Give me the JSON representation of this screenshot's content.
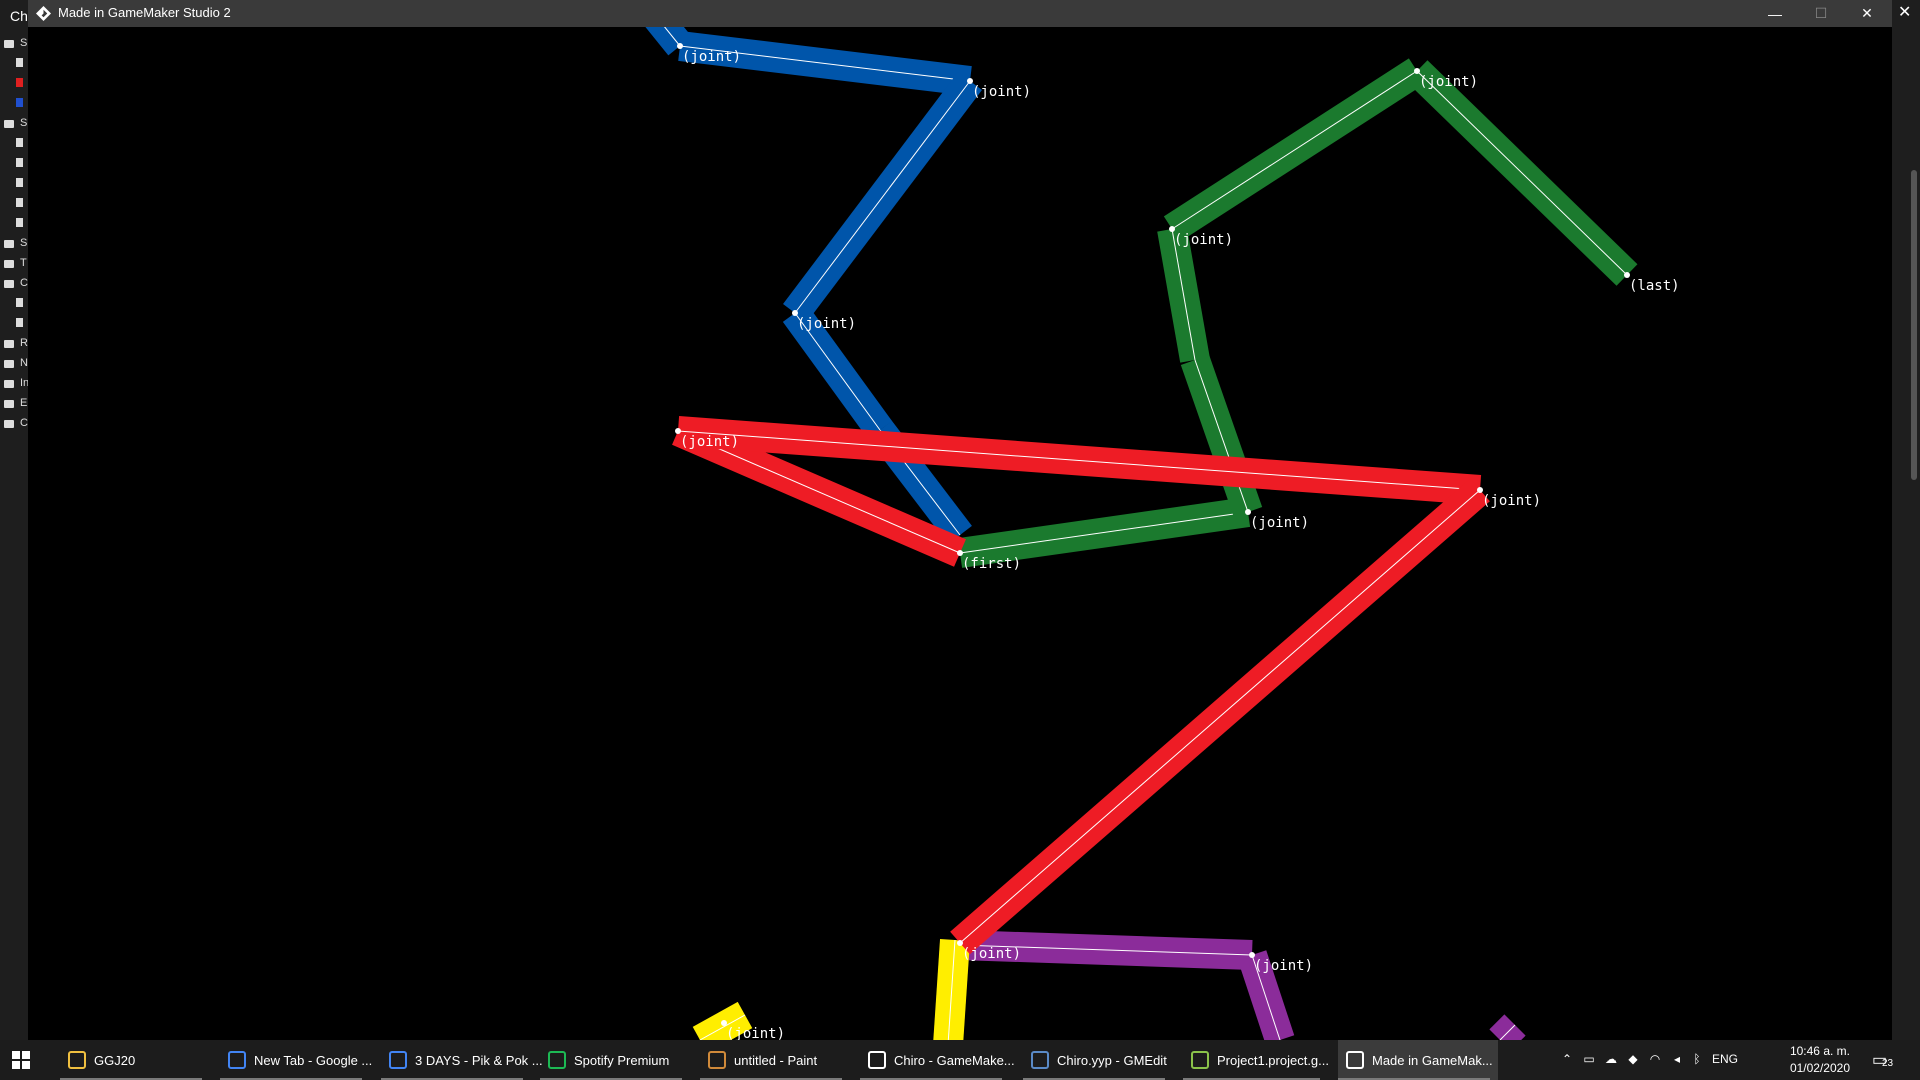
{
  "window": {
    "title": "Made in GameMaker Studio 2",
    "minimize_glyph": "—",
    "maximize_glyph": "☐",
    "close_glyph": "✕"
  },
  "background_editor": {
    "header_fragment": "Ch",
    "tree_letters": [
      "S",
      "S",
      "S",
      "T",
      "C",
      "R",
      "N",
      "In",
      "E",
      "C"
    ]
  },
  "game": {
    "background": "#000000",
    "joint_label": "(joint)",
    "first_label": "(first)",
    "last_label": "(last)",
    "colors": {
      "blue": "#0055aa",
      "green": "#1b7a2e",
      "red": "#ee1c25",
      "purple": "#8b2c9a",
      "yellow": "#ffee00",
      "link": "#ffffff"
    }
  },
  "taskbar": {
    "items": [
      {
        "label": "GGJ20",
        "icon": "folder-icon",
        "color": "#f0c040"
      },
      {
        "label": "New Tab - Google ...",
        "icon": "chrome-icon",
        "color": "#4285f4"
      },
      {
        "label": "3 DAYS - Pik & Pok ...",
        "icon": "chrome-icon",
        "color": "#4285f4"
      },
      {
        "label": "Spotify Premium",
        "icon": "spotify-icon",
        "color": "#1db954"
      },
      {
        "label": "untitled - Paint",
        "icon": "paint-icon",
        "color": "#d08a3a"
      },
      {
        "label": "Chiro - GameMake...",
        "icon": "gamemaker-icon",
        "color": "#ffffff"
      },
      {
        "label": "Chiro.yyp - GMEdit",
        "icon": "gmedit-icon",
        "color": "#5a8ac6"
      },
      {
        "label": "Project1.project.g...",
        "icon": "gamemaker-alt-icon",
        "color": "#8bc34a"
      },
      {
        "label": "Made in GameMak...",
        "icon": "gamemaker-icon",
        "color": "#ffffff"
      }
    ],
    "tray": {
      "language": "ENG",
      "time": "10:46 a. m.",
      "date": "01/02/2020",
      "notification_count": "23"
    }
  }
}
